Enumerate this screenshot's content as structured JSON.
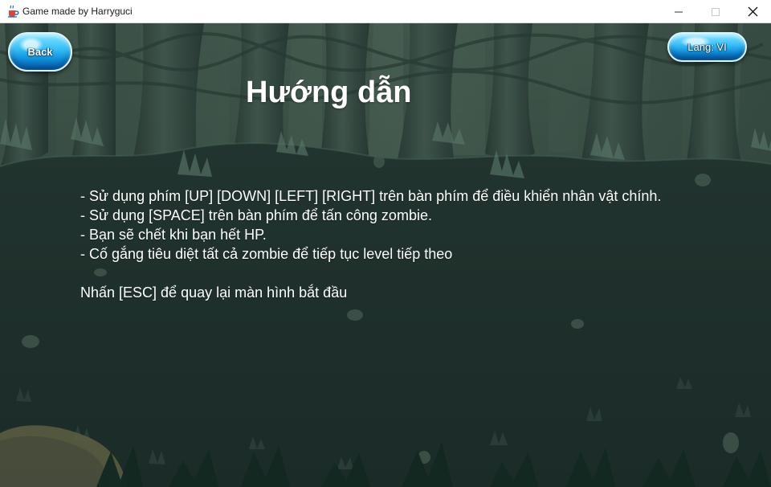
{
  "window": {
    "title": "Game made by Harryguci",
    "controls": [
      "minimize",
      "maximize",
      "close"
    ]
  },
  "buttons": {
    "back": "Back",
    "language": "Lang: VI"
  },
  "screen": {
    "title": "Hướng dẫn",
    "instructions": [
      "- Sử dụng phím [UP] [DOWN] [LEFT] [RIGHT] trên bàn phím để điều khiển nhân vật chính.",
      "- Sử dụng [SPACE] trên bàn phím để tấn công zombie.",
      "- Bạn sẽ chết khi bạn hết HP.",
      "- Cố gắng tiêu diệt tất cả zombie để tiếp tục level tiếp theo"
    ],
    "esc_hint": "Nhấn [ESC] để quay lại màn hình bắt đầu"
  },
  "icons": {
    "app": "java-cup-icon",
    "minimize": "minimize-icon",
    "maximize": "maximize-icon",
    "close": "close-icon"
  },
  "colors": {
    "forest_dark": "#1f2f2b",
    "button_blue": "#36bff7",
    "text": "#ffffff"
  }
}
